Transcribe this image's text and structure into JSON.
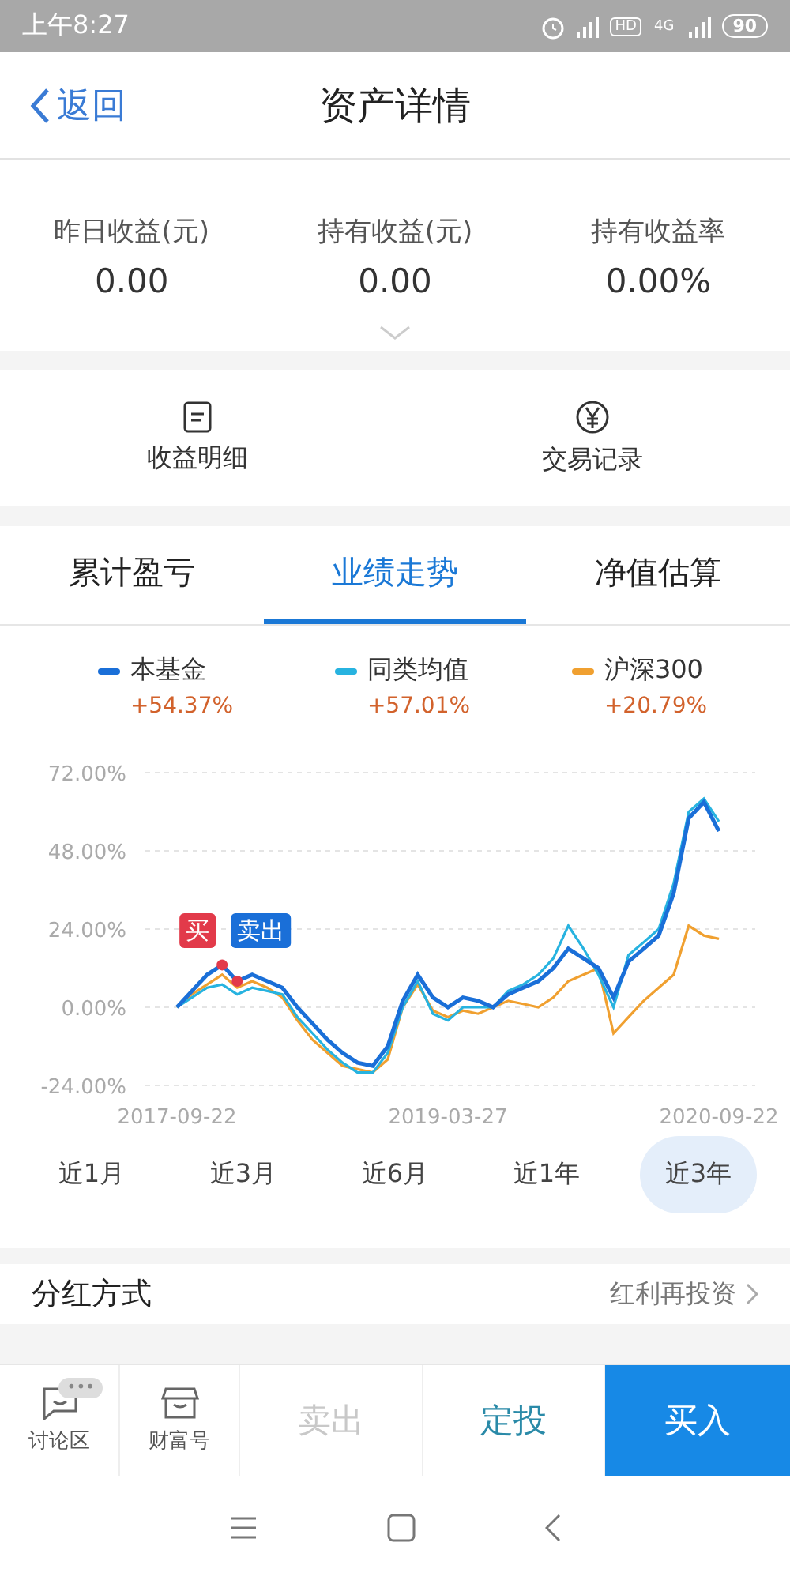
{
  "status_bar": {
    "time": "上午8:27",
    "hd": "HD",
    "network": "4G",
    "battery": "90"
  },
  "header": {
    "back": "返回",
    "title": "资产详情"
  },
  "stats": [
    {
      "label": "昨日收益(元)",
      "value": "0.00"
    },
    {
      "label": "持有收益(元)",
      "value": "0.00"
    },
    {
      "label": "持有收益率",
      "value": "0.00%"
    }
  ],
  "shortcuts": [
    {
      "kind": "document",
      "label": "收益明细"
    },
    {
      "kind": "yen",
      "label": "交易记录"
    }
  ],
  "tabs": [
    {
      "label": "累计盈亏",
      "selected": false
    },
    {
      "label": "业绩走势",
      "selected": true
    },
    {
      "label": "净值估算",
      "selected": false
    }
  ],
  "legend": [
    {
      "change": "+54.37%"
    },
    {
      "change": "+57.01%"
    },
    {
      "change": "+20.79%"
    }
  ],
  "chart_data": {
    "type": "line",
    "categories": [
      "2017-09-22",
      null,
      null,
      null,
      null,
      null,
      null,
      null,
      null,
      null,
      null,
      null,
      null,
      null,
      null,
      null,
      null,
      null,
      "2019-03-27",
      null,
      null,
      null,
      null,
      null,
      null,
      null,
      null,
      null,
      null,
      null,
      null,
      null,
      null,
      null,
      null,
      null,
      "2020-09-22"
    ],
    "yticks": [
      {
        "value": -24,
        "label": "-24.00%"
      },
      {
        "value": 0,
        "label": "0.00%"
      },
      {
        "value": 24,
        "label": "24.00%"
      },
      {
        "value": 48,
        "label": "48.00%"
      },
      {
        "value": 72,
        "label": "72.00%"
      }
    ],
    "ylim": [
      -24,
      72
    ],
    "series": [
      {
        "name": "本基金",
        "color": "#1a6fd8",
        "values": [
          0,
          5,
          10,
          13,
          8,
          10,
          8,
          6,
          0,
          -5,
          -10,
          -14,
          -17,
          -18,
          -12,
          2,
          10,
          3,
          0,
          3,
          2,
          0,
          4,
          6,
          8,
          12,
          18,
          15,
          12,
          3,
          14,
          18,
          22,
          35,
          58,
          63,
          54
        ]
      },
      {
        "name": "同类均值",
        "color": "#27b3e0",
        "values": [
          0,
          3,
          6,
          7,
          4,
          6,
          5,
          4,
          -3,
          -8,
          -13,
          -17,
          -20,
          -20,
          -14,
          0,
          8,
          -2,
          -4,
          0,
          0,
          0,
          5,
          7,
          10,
          15,
          25,
          18,
          10,
          0,
          16,
          20,
          24,
          38,
          60,
          64,
          57
        ]
      },
      {
        "name": "沪深300",
        "color": "#f0a030",
        "values": [
          0,
          4,
          7,
          10,
          6,
          8,
          6,
          3,
          -4,
          -10,
          -14,
          -18,
          -19,
          -20,
          -16,
          0,
          7,
          -1,
          -3,
          -1,
          -2,
          0,
          2,
          1,
          0,
          3,
          8,
          10,
          12,
          -8,
          -3,
          2,
          6,
          10,
          25,
          22,
          21
        ]
      }
    ],
    "annotations": [
      {
        "text": "买"
      },
      {
        "text": "卖出"
      }
    ],
    "grid": true
  },
  "ranges": [
    {
      "label": "近1月",
      "selected": false
    },
    {
      "label": "近3月",
      "selected": false
    },
    {
      "label": "近6月",
      "selected": false
    },
    {
      "label": "近1年",
      "selected": false
    },
    {
      "label": "近3年",
      "selected": true
    }
  ],
  "dividend": {
    "label": "分红方式",
    "value": "红利再投资"
  },
  "bottom_bar": [
    {
      "kind": "chat",
      "label": "讨论区",
      "badge": "•••"
    },
    {
      "kind": "store",
      "label": "财富号"
    },
    {
      "kind": "text",
      "label": "卖出",
      "disabled": true
    },
    {
      "kind": "text",
      "label": "定投",
      "disabled": false
    },
    {
      "kind": "primary",
      "label": "买入"
    }
  ]
}
